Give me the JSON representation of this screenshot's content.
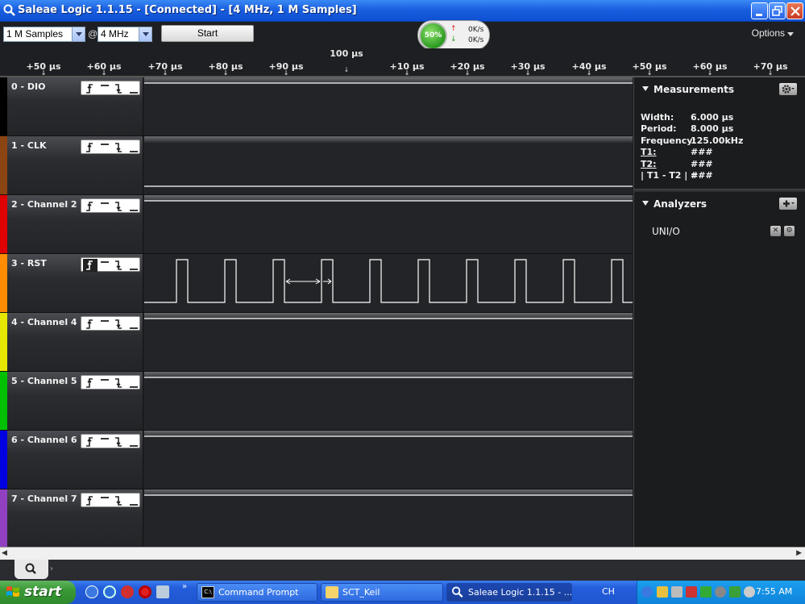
{
  "window": {
    "title": "Saleae Logic 1.1.15 - [Connected] - [4 MHz, 1 M Samples]"
  },
  "toolbar": {
    "samples_value": "1 M Samples",
    "at_label": "@",
    "rate_value": "4 MHz",
    "start_label": "Start",
    "options_label": "Options",
    "gauge_percent": "50%",
    "gauge_up_rate": "0K/s",
    "gauge_down_rate": "0K/s"
  },
  "ruler": {
    "center_label": "100 µs",
    "ticks": [
      "+50 µs",
      "+60 µs",
      "+70 µs",
      "+80 µs",
      "+90 µs",
      "+10 µs",
      "+20 µs",
      "+30 µs",
      "+40 µs",
      "+50 µs",
      "+60 µs",
      "+70 µs"
    ]
  },
  "channels": [
    {
      "name": "0 - DIO",
      "color": "#000000"
    },
    {
      "name": "1 - CLK",
      "color": "#8b4513"
    },
    {
      "name": "2 - Channel 2",
      "color": "#e00000"
    },
    {
      "name": "3 - RST",
      "color": "#ff8c00"
    },
    {
      "name": "4 - Channel 4",
      "color": "#e6e600"
    },
    {
      "name": "5 - Channel 5",
      "color": "#00c000"
    },
    {
      "name": "6 - Channel 6",
      "color": "#0000e0"
    },
    {
      "name": "7 - Channel 7",
      "color": "#9040c0"
    }
  ],
  "measurements": {
    "title": "Measurements",
    "rows": [
      {
        "label": "Width:",
        "value": "6.000 µs"
      },
      {
        "label": "Period:",
        "value": "8.000 µs"
      },
      {
        "label": "Frequency:",
        "value": "125.00kHz"
      },
      {
        "label": "T1:",
        "value": "###"
      },
      {
        "label": "T2:",
        "value": "###"
      },
      {
        "label": "| T1 - T2 | =",
        "value": "###"
      }
    ]
  },
  "analyzers": {
    "title": "Analyzers",
    "items": [
      "UNI/O"
    ]
  },
  "taskbar": {
    "start_label": "start",
    "tasks": [
      "Command Prompt",
      "SCT_Keil",
      "Saleae Logic 1.1.15 - ..."
    ],
    "lang": "CH",
    "clock": "7:55 AM"
  }
}
